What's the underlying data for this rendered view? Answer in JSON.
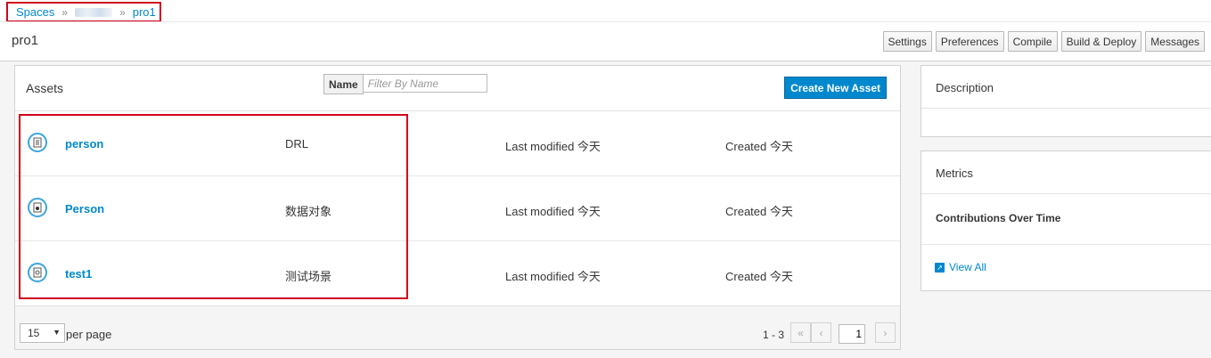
{
  "breadcrumb": {
    "spaces": "Spaces",
    "separator": "»",
    "project": "pro1"
  },
  "project": {
    "title": "pro1"
  },
  "toolbar": {
    "settings": "Settings",
    "preferences": "Preferences",
    "compile": "Compile",
    "build_deploy": "Build & Deploy",
    "messages": "Messages"
  },
  "assets": {
    "title": "Assets",
    "filter_label": "Name",
    "filter_placeholder": "Filter By Name",
    "create_button": "Create New Asset",
    "rows": [
      {
        "icon": "drl-file-icon",
        "name": "person",
        "type": "DRL",
        "modified": "Last modified 今天",
        "created": "Created 今天"
      },
      {
        "icon": "data-object-icon",
        "name": "Person",
        "type": "数据对象",
        "modified": "Last modified 今天",
        "created": "Created 今天"
      },
      {
        "icon": "test-scenario-icon",
        "name": "test1",
        "type": "测试场景",
        "modified": "Last modified 今天",
        "created": "Created 今天"
      }
    ],
    "per_page_value": "15",
    "per_page_label": "per page",
    "range": "1 - 3",
    "page": "1"
  },
  "description": {
    "title": "Description"
  },
  "metrics": {
    "title": "Metrics",
    "contributions": "Contributions Over Time",
    "view_all": "View All"
  },
  "colors": {
    "accent": "#0088ce",
    "highlight": "#d0021b",
    "icon_ring": "#39a5dc"
  }
}
